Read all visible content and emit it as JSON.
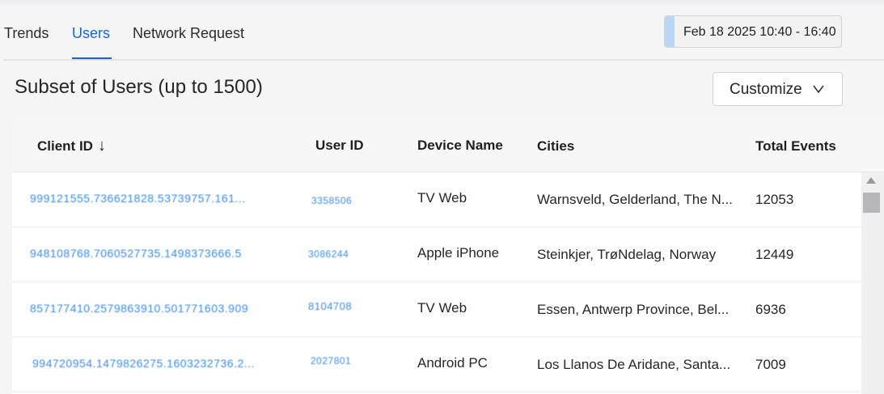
{
  "tabs": [
    {
      "label": "Trends",
      "active": false
    },
    {
      "label": "Users",
      "active": true
    },
    {
      "label": "Network Request",
      "active": false
    }
  ],
  "date_range": "Feb 18 2025 10:40 - 16:40",
  "section": {
    "title": "Subset of Users (up to 1500)",
    "customize_label": "Customize"
  },
  "table": {
    "columns": [
      "Client ID",
      "User ID",
      "Device Name",
      "Cities",
      "Total Events"
    ],
    "sort_indicator": "↓",
    "rows": [
      {
        "client_id": "999121555.736621828.53739757.161...",
        "user_id": "3358506",
        "device": "TV Web",
        "city": "Warnsveld, Gelderland, The N...",
        "events": "12053"
      },
      {
        "client_id": "948108768.7060527735.1498373666.5",
        "user_id": "3086244",
        "device": "Apple iPhone",
        "city": "Steinkjer, TrøNdelag, Norway",
        "events": "12449"
      },
      {
        "client_id": "857177410.2579863910.501771603.909",
        "user_id": "8104708",
        "device": "TV Web",
        "city": "Essen, Antwerp Province, Bel...",
        "events": "6936"
      },
      {
        "client_id": "994720954.1479826275.1603232736.2...",
        "user_id": "2027801",
        "device": "Android PC",
        "city": "Los Llanos De Aridane, Santa...",
        "events": "7009"
      }
    ]
  },
  "colors": {
    "accent": "#1a62d8",
    "link": "#3b8ae6",
    "date_accent": "#b9d6f4"
  }
}
